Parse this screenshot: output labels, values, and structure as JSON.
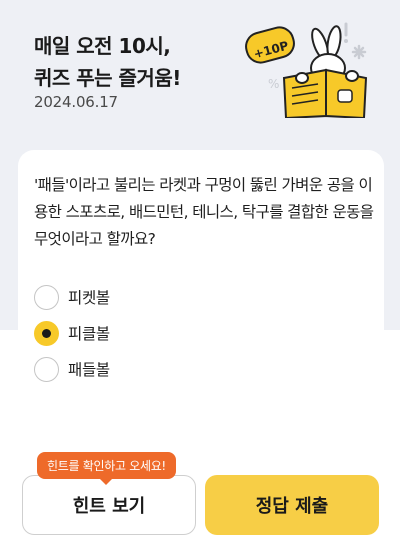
{
  "header": {
    "title": "매일 오전 10시,\n퀴즈 푸는 즐거움!",
    "date": "2024.06.17",
    "badge": "+10P"
  },
  "quiz": {
    "question": "'패들'이라고 불리는 라켓과 구멍이 뚫린 가벼운 공을 이용한 스포츠로, 배드민턴, 테니스, 탁구를 결합한 운동을 무엇이라고 할까요?",
    "options": [
      {
        "label": "피켓볼",
        "selected": false
      },
      {
        "label": "피클볼",
        "selected": true
      },
      {
        "label": "패들볼",
        "selected": false
      }
    ]
  },
  "actions": {
    "hint_tooltip": "힌트를 확인하고 오세요!",
    "hint_label": "힌트 보기",
    "submit_label": "정답 제출"
  },
  "colors": {
    "accent": "#f7ce46",
    "tooltip": "#ee6a2a",
    "header_bg": "#eef0f5"
  },
  "icons": [
    "rabbit-reading-book-illustration",
    "radio-selected-icon",
    "radio-empty-icon"
  ]
}
